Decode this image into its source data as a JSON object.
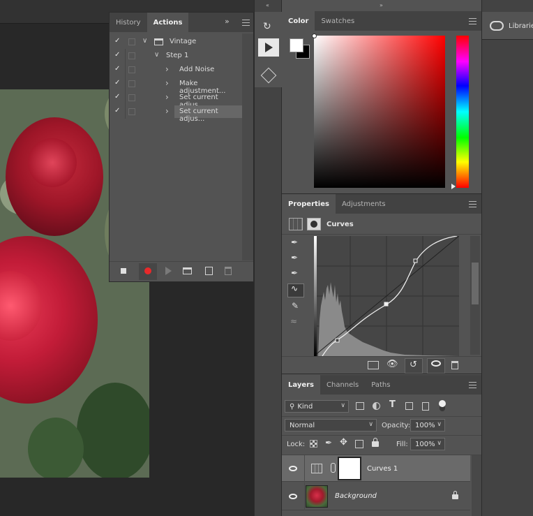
{
  "actions_panel": {
    "tabs": [
      {
        "label": "History"
      },
      {
        "label": "Actions"
      }
    ],
    "items": [
      {
        "label": "Vintage",
        "level": 0,
        "toggle": "✓",
        "disclosure": "∨"
      },
      {
        "label": "Step 1",
        "level": 1,
        "toggle": "✓",
        "disclosure": "∨"
      },
      {
        "label": "Add Noise",
        "level": 2,
        "toggle": "✓",
        "disclosure": "›"
      },
      {
        "label": "Make adjustment...",
        "level": 2,
        "toggle": "✓",
        "disclosure": "›"
      },
      {
        "label": "Set current adjus...",
        "level": 2,
        "toggle": "✓",
        "disclosure": "›"
      },
      {
        "label": "Set current adjus...",
        "level": 2,
        "toggle": "✓",
        "disclosure": "›",
        "selected": true
      }
    ],
    "footer_icons": [
      "stop-icon",
      "record-icon",
      "play-icon",
      "folder-icon",
      "new-action-icon",
      "delete-icon"
    ]
  },
  "color_panel": {
    "tabs": [
      {
        "label": "Color"
      },
      {
        "label": "Swatches"
      }
    ],
    "foreground": "#ffffff",
    "background": "#000000",
    "hue": "#ff0000"
  },
  "properties_panel": {
    "tabs": [
      {
        "label": "Properties"
      },
      {
        "label": "Adjustments"
      }
    ],
    "title": "Curves",
    "curve_points": [
      [
        0.2,
        0.1
      ],
      [
        0.5,
        0.45
      ],
      [
        0.72,
        0.78
      ],
      [
        1.0,
        1.0
      ]
    ]
  },
  "libraries": {
    "label": "Librarie"
  },
  "layers_panel": {
    "tabs": [
      {
        "label": "Layers"
      },
      {
        "label": "Channels"
      },
      {
        "label": "Paths"
      }
    ],
    "filter": "Kind",
    "blend_mode": "Normal",
    "opacity_label": "Opacity:",
    "opacity": "100%",
    "lock_label": "Lock:",
    "fill_label": "Fill:",
    "fill": "100%",
    "layers": [
      {
        "name": "Curves 1",
        "selected": true
      },
      {
        "name": "Background",
        "selected": false
      }
    ]
  }
}
